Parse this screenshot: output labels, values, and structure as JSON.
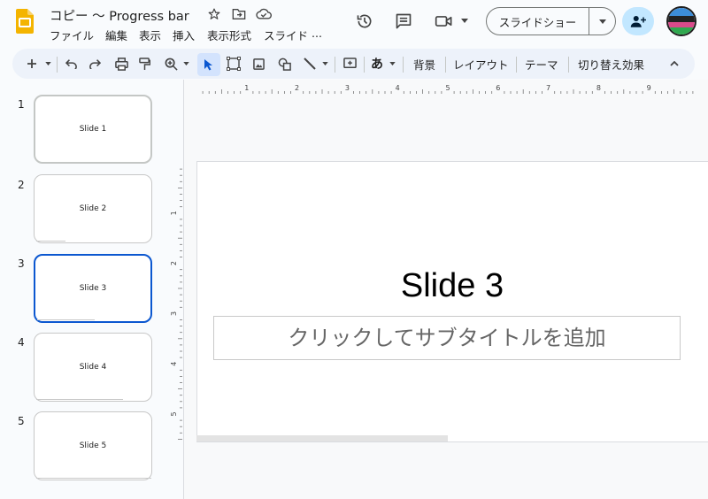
{
  "doc_title": "コピー 〜 Progress bar",
  "menu": [
    "ファイル",
    "編集",
    "表示",
    "挿入",
    "表示形式",
    "スライド",
    "..."
  ],
  "header": {
    "slideshow_label": "スライドショー"
  },
  "toolbar": {
    "background": "背景",
    "layout": "レイアウト",
    "theme": "テーマ",
    "transition": "切り替え効果",
    "input_tool": "あ"
  },
  "slides": [
    {
      "number": "1",
      "label": "Slide 1",
      "progress": 0.0
    },
    {
      "number": "2",
      "label": "Slide 2",
      "progress": 0.25
    },
    {
      "number": "3",
      "label": "Slide 3",
      "progress": 0.5
    },
    {
      "number": "4",
      "label": "Slide 4",
      "progress": 0.75
    },
    {
      "number": "5",
      "label": "Slide 5",
      "progress": 1.0
    }
  ],
  "selected_slide": 3,
  "editor": {
    "title": "Slide 3",
    "subtitle_placeholder": "クリックしてサブタイトルを追加",
    "ruler_h": [
      "1",
      "2",
      "3",
      "4",
      "5",
      "6",
      "7",
      "8",
      "9"
    ],
    "ruler_v": [
      "1",
      "2",
      "3",
      "4",
      "5"
    ]
  },
  "colors": {
    "accent": "#0b57d0",
    "share_bg": "#c2e7ff",
    "toolbar_bg": "#edf2fa",
    "app_icon": "#f4b400"
  }
}
